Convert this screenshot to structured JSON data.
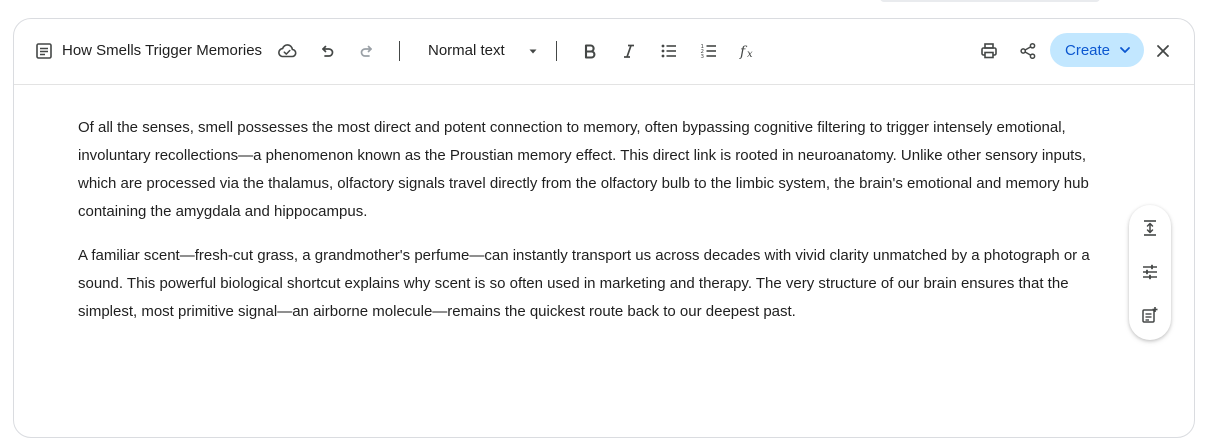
{
  "toolbar": {
    "doc_title": "How Smells Trigger Memories",
    "text_style": "Normal text",
    "create_label": "Create",
    "icons": {
      "document": "document-icon",
      "cloud": "cloud-icon",
      "undo": "undo-icon",
      "redo": "redo-icon",
      "bold": "bold-icon",
      "italic": "italic-icon",
      "bulleted_list": "bulleted-list-icon",
      "numbered_list": "numbered-list-icon",
      "formula": "formula-icon",
      "print": "print-icon",
      "share": "share-icon",
      "close": "close-icon"
    }
  },
  "document": {
    "paragraphs": [
      "Of all the senses, smell possesses the most direct and potent connection to memory, often bypassing cognitive filtering to trigger intensely emotional, involuntary recollections—a phenomenon known as the Proustian memory effect. This direct link is rooted in neuroanatomy. Unlike other sensory inputs, which are processed via the thalamus, olfactory signals travel directly from the olfactory bulb to the limbic system, the brain's emotional and memory hub containing the amygdala and hippocampus.",
      "A familiar scent—fresh-cut grass, a grandmother's perfume—can instantly transport us across decades with vivid clarity unmatched by a photograph or a sound. This powerful biological shortcut explains why scent is so often used in marketing and therapy. The very structure of our brain ensures that the simplest, most primitive signal—an airborne molecule—remains the quickest route back to our deepest past."
    ]
  },
  "side_panel": {
    "icons": [
      "line-spacing-icon",
      "adjust-settings-icon",
      "add-notes-icon"
    ]
  },
  "colors": {
    "accent_button_bg": "#c2e7ff",
    "accent_button_text": "#0b57d0",
    "text": "#1f1f1f",
    "disabled_icon": "#9aa0a6"
  }
}
